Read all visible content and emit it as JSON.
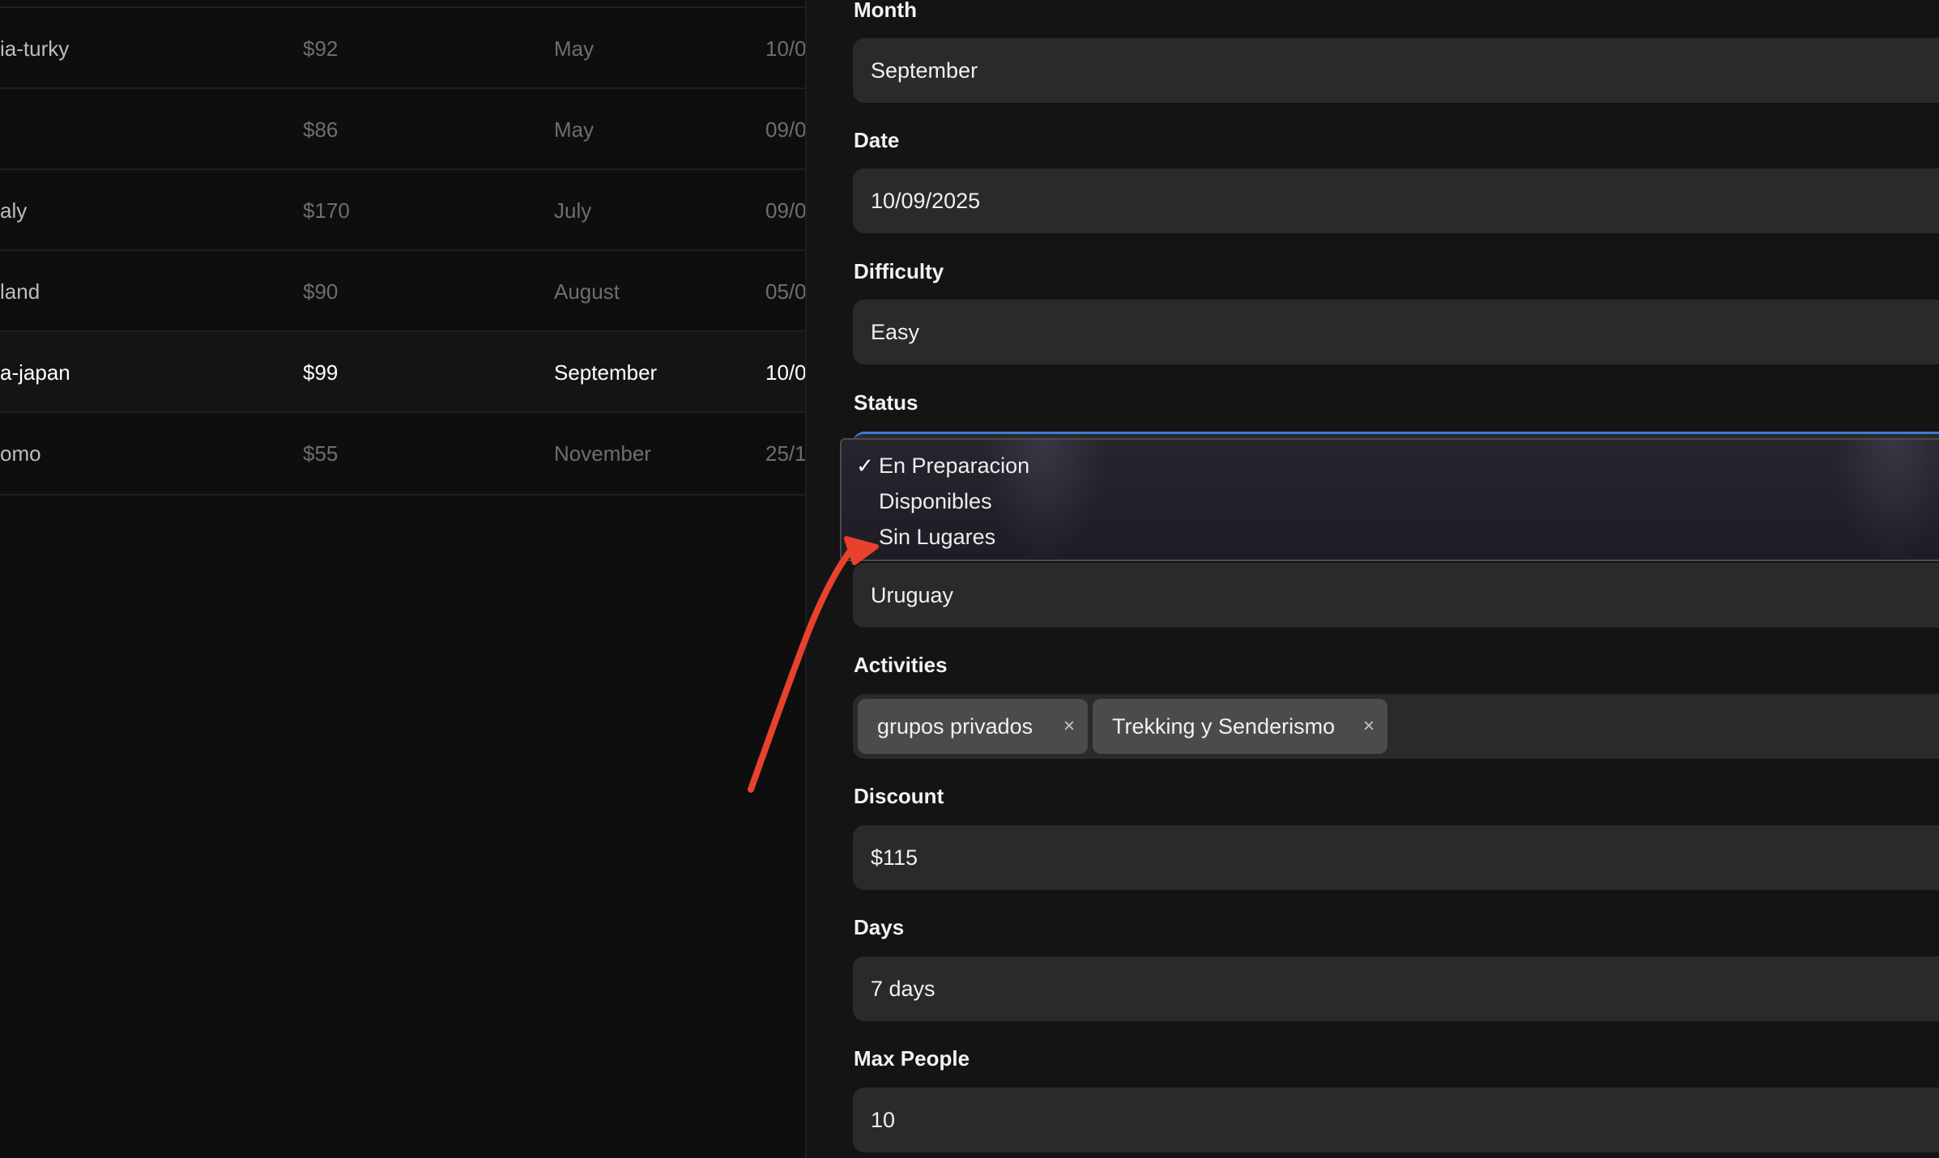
{
  "table": {
    "rows": [
      {
        "name": "ia-turky",
        "price": "$92",
        "month": "May",
        "date": "10/0"
      },
      {
        "name": "",
        "price": "$86",
        "month": "May",
        "date": "09/0"
      },
      {
        "name": "aly",
        "price": "$170",
        "month": "July",
        "date": "09/0"
      },
      {
        "name": "land",
        "price": "$90",
        "month": "August",
        "date": "05/0"
      },
      {
        "name": "a-japan",
        "price": "$99",
        "month": "September",
        "date": "10/0"
      },
      {
        "name": "omo",
        "price": "$55",
        "month": "November",
        "date": "25/1"
      }
    ]
  },
  "form": {
    "month": {
      "label": "Month",
      "value": "September"
    },
    "date": {
      "label": "Date",
      "value": "10/09/2025"
    },
    "difficulty": {
      "label": "Difficulty",
      "value": "Easy"
    },
    "status": {
      "label": "Status",
      "options": [
        {
          "label": "En Preparacion",
          "check": "✓"
        },
        {
          "label": "Disponibles",
          "check": ""
        },
        {
          "label": "Sin Lugares",
          "check": ""
        }
      ]
    },
    "country": {
      "value": "Uruguay"
    },
    "activities": {
      "label": "Activities",
      "tags": [
        {
          "label": "grupos privados",
          "remove": "×"
        },
        {
          "label": "Trekking y Senderismo",
          "remove": "×"
        }
      ]
    },
    "discount": {
      "label": "Discount",
      "value": "$115"
    },
    "days": {
      "label": "Days",
      "value": "7 days"
    },
    "max_people": {
      "label": "Max People",
      "value": "10"
    }
  },
  "colors": {
    "background": "#121213",
    "field": "#2a2a2b",
    "focus_border": "#3d7bd9",
    "annotation_arrow": "#e8412c"
  },
  "icons": {
    "selected_option": "check-icon",
    "tag_remove": "close-icon",
    "annotation": "arrow-annotation"
  }
}
